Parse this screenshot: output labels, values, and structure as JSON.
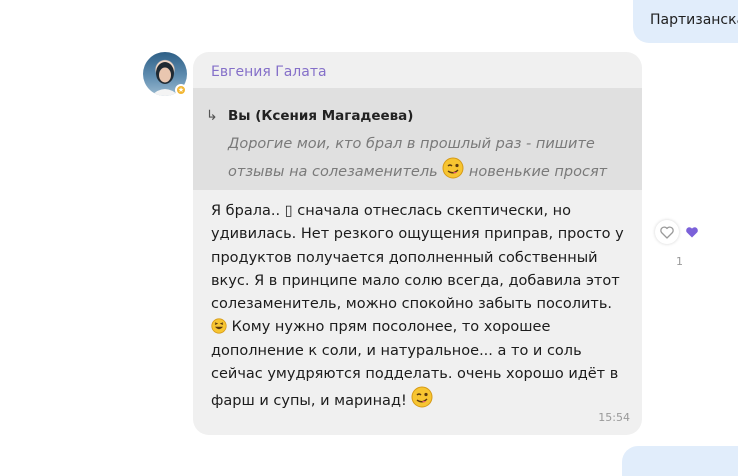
{
  "outgoing_top": {
    "text": "Партизанская"
  },
  "message": {
    "sender": "Евгения Галата",
    "reply": {
      "arrow": "↳",
      "author": "Вы (Ксения Магадеева)",
      "text_part1": "Дорогие мои, кто брал в прошлый раз - пишите отзывы на солезаменитель ",
      "text_part2": " новенькие просят",
      "emoji": "winking-face-emoji"
    },
    "body_part1": "Я брала.. ▯ сначала отнеслась скептически, но удивилась. Нет резкого ощущения приправ, просто у продуктов получается дополненный собственный вкус. Я в принципе мало солю всегда, добавила этот солезаменитель, можно спокойно забыть посолить. ",
    "body_part2": " Кому нужно прям посолонее, то хорошее дополнение к соли, и натуральное... а то и соль сейчас умудряются подделать. очень хорошо идёт в фарш и супы, и маринад! ",
    "time": "15:54"
  },
  "reactions": {
    "count": "1",
    "filled_heart_color": "#7b61d9"
  },
  "colors": {
    "sender": "#8570c9",
    "bubble": "#f0f0f0",
    "reply_bg": "#e0e0e0",
    "outgoing_bubble": "#e1edfb"
  }
}
